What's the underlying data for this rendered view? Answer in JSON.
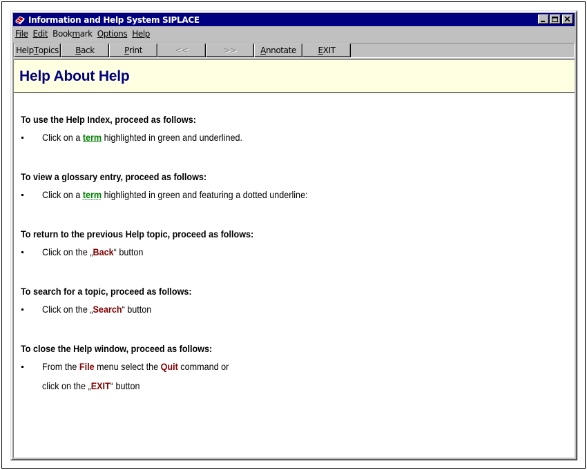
{
  "window": {
    "title": "Information and Help System SIPLACE"
  },
  "menu": {
    "file": "File",
    "edit": "Edit",
    "bookmark_pre": "Book",
    "bookmark_ul": "m",
    "bookmark_post": "ark",
    "options": "Options",
    "help": "Help"
  },
  "toolbar": {
    "help_topics_pre": "Help ",
    "help_topics_ul": "T",
    "help_topics_post": "opics",
    "back_ul": "B",
    "back_post": "ack",
    "print_ul": "P",
    "print_post": "rint",
    "prev": "<<",
    "next": ">>",
    "annotate_ul": "A",
    "annotate_post": "nnotate",
    "exit_ul": "E",
    "exit_post": "XIT"
  },
  "page": {
    "title": "Help About Help",
    "sections": [
      {
        "heading": "To use the Help Index, proceed as follows:",
        "line_pre": "Click on a ",
        "line_term": "term",
        "line_post": " highlighted in green and underlined."
      },
      {
        "heading": "To view a glossary entry, proceed as follows:",
        "line_pre": "Click on a ",
        "line_term": "term",
        "line_post": " highlighted in green and featuring a dotted underline:"
      },
      {
        "heading": "To return to the previous Help topic, proceed as follows:",
        "line_pre": "Click on the „",
        "line_kw": "Back",
        "line_post": "“ button"
      },
      {
        "heading": "To search for a topic, proceed as follows:",
        "line_pre": "Click on the „",
        "line_kw": "Search",
        "line_post": "“ button"
      },
      {
        "heading": "To close the Help window, proceed as follows:",
        "line_pre": "From the ",
        "line_kw1": "File",
        "line_mid": " menu select the ",
        "line_kw2": "Quit",
        "line_post": " command or",
        "line2_pre": "click on the „",
        "line2_kw": "EXIT",
        "line2_post": "“ button"
      }
    ]
  },
  "colors": {
    "titlebar": "#000080",
    "header_band": "#ffffe1",
    "page_title": "#000080",
    "term_link": "#008000",
    "keyword": "#800000"
  },
  "icons": {
    "app": "book-icon",
    "minimize": "minimize-icon",
    "maximize": "maximize-icon",
    "close": "close-icon"
  }
}
